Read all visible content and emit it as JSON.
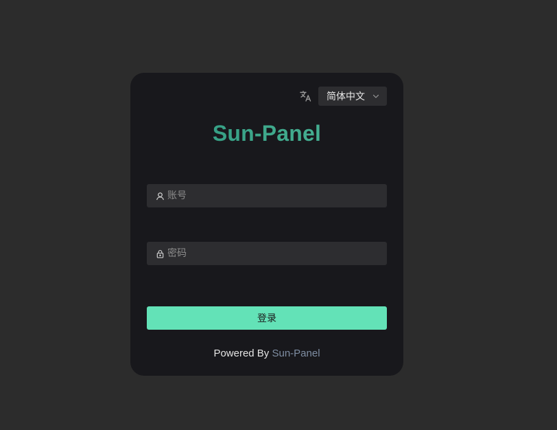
{
  "language": {
    "selected": "简体中文",
    "icon": "translate-icon"
  },
  "brand": {
    "title": "Sun-Panel",
    "title_color": "#3ea88b"
  },
  "form": {
    "username_placeholder": "账号",
    "password_placeholder": "密码",
    "login_label": "登录",
    "login_color": "#63e2b7"
  },
  "footer": {
    "powered_by": "Powered By",
    "link_text": "Sun-Panel",
    "link_color": "#7f8ea3"
  }
}
